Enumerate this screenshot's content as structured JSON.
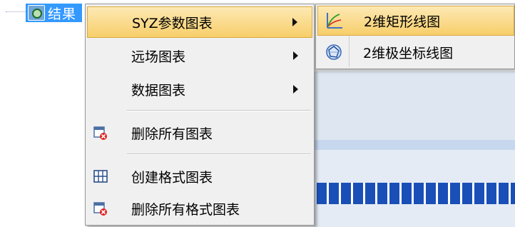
{
  "tree": {
    "node_label": "结果",
    "icon": "result-icon"
  },
  "menu": {
    "items": [
      {
        "label": "SYZ参数图表",
        "has_submenu": true,
        "icon": "",
        "highlighted": true
      },
      {
        "label": "远场图表",
        "has_submenu": true,
        "icon": ""
      },
      {
        "label": "数据图表",
        "has_submenu": true,
        "icon": ""
      },
      {
        "label": "删除所有图表",
        "has_submenu": false,
        "icon": "delete-charts-icon"
      },
      {
        "label": "创建格式图表",
        "has_submenu": false,
        "icon": "grid-table-icon"
      },
      {
        "label": "删除所有格式图表",
        "has_submenu": false,
        "icon": "delete-format-charts-icon"
      }
    ]
  },
  "submenu": {
    "items": [
      {
        "label": "2维矩形线图",
        "icon": "rect-line-chart-icon",
        "highlighted": true
      },
      {
        "label": "2维极坐标线图",
        "icon": "polar-line-chart-icon"
      }
    ]
  },
  "colors": {
    "highlight": "#f7ce6a",
    "selection": "#3399ff",
    "progress": "#1a4fb8"
  }
}
